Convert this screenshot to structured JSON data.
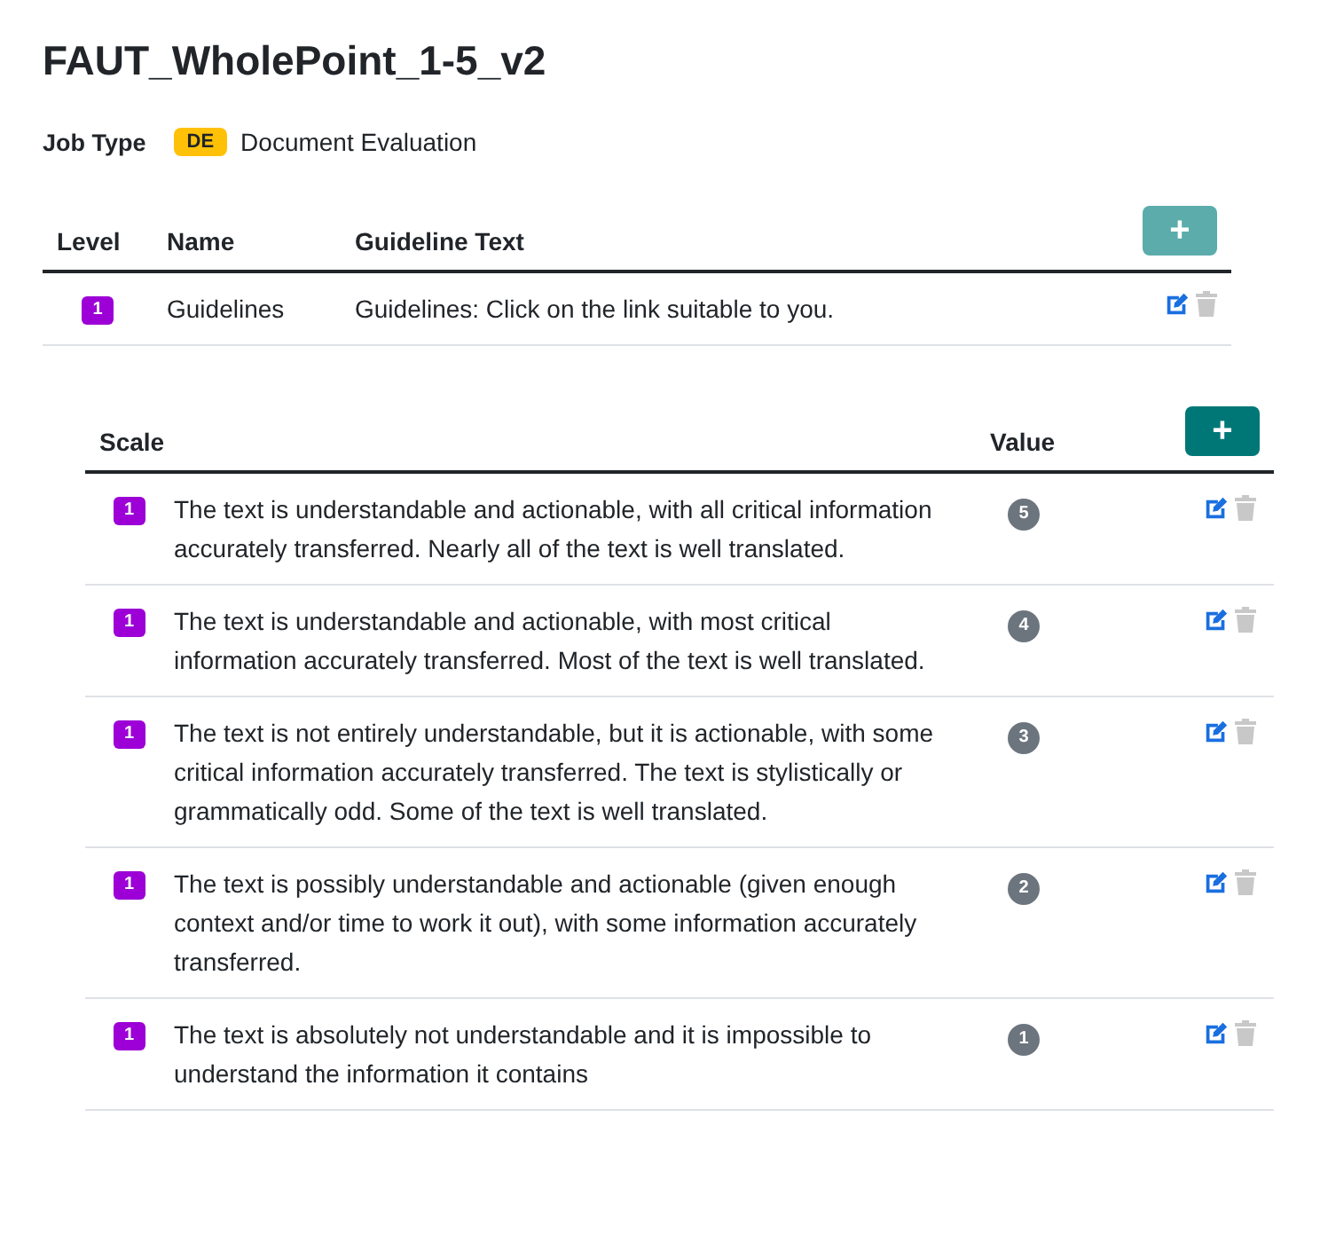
{
  "title": "FAUT_WholePoint_1-5_v2",
  "job_type": {
    "label": "Job Type",
    "badge": "DE",
    "value": "Document Evaluation"
  },
  "guidelines_table": {
    "columns": [
      "Level",
      "Name",
      "Guideline Text"
    ],
    "add_button": "+",
    "rows": [
      {
        "level": "1",
        "name": "Guidelines",
        "text": "Guidelines: Click on the link suitable to you."
      }
    ]
  },
  "scale_table": {
    "columns": [
      "Scale",
      "Value"
    ],
    "add_button": "+",
    "rows": [
      {
        "level": "1",
        "text": "The text is understandable and actionable, with all critical information accurately transferred. Nearly all of the text is well translated.",
        "value": "5"
      },
      {
        "level": "1",
        "text": "The text is understandable and actionable, with most critical information accurately transferred. Most of the text is well translated.",
        "value": "4"
      },
      {
        "level": "1",
        "text": "The text is not entirely understandable, but it is actionable, with some critical information accurately transferred. The text is stylistically or grammatically odd. Some of the text is well translated.",
        "value": "3"
      },
      {
        "level": "1",
        "text": "The text is possibly understandable and actionable (given enough context and/or time to work it out), with some information accurately transferred.",
        "value": "2"
      },
      {
        "level": "1",
        "text": "The text is absolutely not understandable and it is impossible to understand the information it contains",
        "value": "1"
      }
    ]
  }
}
